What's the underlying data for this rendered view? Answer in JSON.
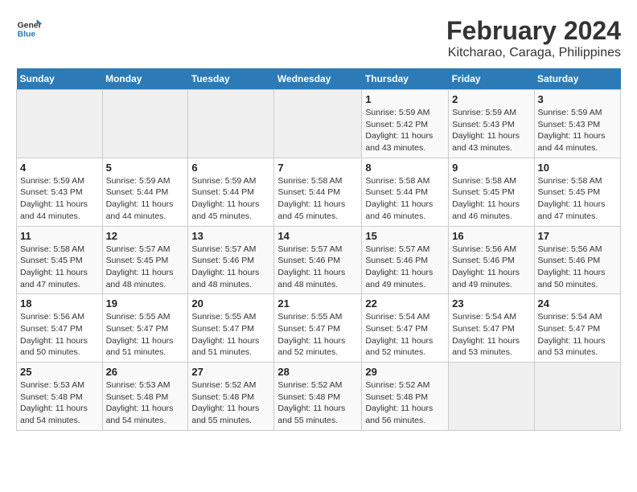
{
  "logo": {
    "text_general": "General",
    "text_blue": "Blue"
  },
  "title": "February 2024",
  "subtitle": "Kitcharao, Caraga, Philippines",
  "days_header": [
    "Sunday",
    "Monday",
    "Tuesday",
    "Wednesday",
    "Thursday",
    "Friday",
    "Saturday"
  ],
  "weeks": [
    [
      {
        "day": "",
        "info": ""
      },
      {
        "day": "",
        "info": ""
      },
      {
        "day": "",
        "info": ""
      },
      {
        "day": "",
        "info": ""
      },
      {
        "day": "1",
        "info": "Sunrise: 5:59 AM\nSunset: 5:42 PM\nDaylight: 11 hours\nand 43 minutes."
      },
      {
        "day": "2",
        "info": "Sunrise: 5:59 AM\nSunset: 5:43 PM\nDaylight: 11 hours\nand 43 minutes."
      },
      {
        "day": "3",
        "info": "Sunrise: 5:59 AM\nSunset: 5:43 PM\nDaylight: 11 hours\nand 44 minutes."
      }
    ],
    [
      {
        "day": "4",
        "info": "Sunrise: 5:59 AM\nSunset: 5:43 PM\nDaylight: 11 hours\nand 44 minutes."
      },
      {
        "day": "5",
        "info": "Sunrise: 5:59 AM\nSunset: 5:44 PM\nDaylight: 11 hours\nand 44 minutes."
      },
      {
        "day": "6",
        "info": "Sunrise: 5:59 AM\nSunset: 5:44 PM\nDaylight: 11 hours\nand 45 minutes."
      },
      {
        "day": "7",
        "info": "Sunrise: 5:58 AM\nSunset: 5:44 PM\nDaylight: 11 hours\nand 45 minutes."
      },
      {
        "day": "8",
        "info": "Sunrise: 5:58 AM\nSunset: 5:44 PM\nDaylight: 11 hours\nand 46 minutes."
      },
      {
        "day": "9",
        "info": "Sunrise: 5:58 AM\nSunset: 5:45 PM\nDaylight: 11 hours\nand 46 minutes."
      },
      {
        "day": "10",
        "info": "Sunrise: 5:58 AM\nSunset: 5:45 PM\nDaylight: 11 hours\nand 47 minutes."
      }
    ],
    [
      {
        "day": "11",
        "info": "Sunrise: 5:58 AM\nSunset: 5:45 PM\nDaylight: 11 hours\nand 47 minutes."
      },
      {
        "day": "12",
        "info": "Sunrise: 5:57 AM\nSunset: 5:45 PM\nDaylight: 11 hours\nand 48 minutes."
      },
      {
        "day": "13",
        "info": "Sunrise: 5:57 AM\nSunset: 5:46 PM\nDaylight: 11 hours\nand 48 minutes."
      },
      {
        "day": "14",
        "info": "Sunrise: 5:57 AM\nSunset: 5:46 PM\nDaylight: 11 hours\nand 48 minutes."
      },
      {
        "day": "15",
        "info": "Sunrise: 5:57 AM\nSunset: 5:46 PM\nDaylight: 11 hours\nand 49 minutes."
      },
      {
        "day": "16",
        "info": "Sunrise: 5:56 AM\nSunset: 5:46 PM\nDaylight: 11 hours\nand 49 minutes."
      },
      {
        "day": "17",
        "info": "Sunrise: 5:56 AM\nSunset: 5:46 PM\nDaylight: 11 hours\nand 50 minutes."
      }
    ],
    [
      {
        "day": "18",
        "info": "Sunrise: 5:56 AM\nSunset: 5:47 PM\nDaylight: 11 hours\nand 50 minutes."
      },
      {
        "day": "19",
        "info": "Sunrise: 5:55 AM\nSunset: 5:47 PM\nDaylight: 11 hours\nand 51 minutes."
      },
      {
        "day": "20",
        "info": "Sunrise: 5:55 AM\nSunset: 5:47 PM\nDaylight: 11 hours\nand 51 minutes."
      },
      {
        "day": "21",
        "info": "Sunrise: 5:55 AM\nSunset: 5:47 PM\nDaylight: 11 hours\nand 52 minutes."
      },
      {
        "day": "22",
        "info": "Sunrise: 5:54 AM\nSunset: 5:47 PM\nDaylight: 11 hours\nand 52 minutes."
      },
      {
        "day": "23",
        "info": "Sunrise: 5:54 AM\nSunset: 5:47 PM\nDaylight: 11 hours\nand 53 minutes."
      },
      {
        "day": "24",
        "info": "Sunrise: 5:54 AM\nSunset: 5:47 PM\nDaylight: 11 hours\nand 53 minutes."
      }
    ],
    [
      {
        "day": "25",
        "info": "Sunrise: 5:53 AM\nSunset: 5:48 PM\nDaylight: 11 hours\nand 54 minutes."
      },
      {
        "day": "26",
        "info": "Sunrise: 5:53 AM\nSunset: 5:48 PM\nDaylight: 11 hours\nand 54 minutes."
      },
      {
        "day": "27",
        "info": "Sunrise: 5:52 AM\nSunset: 5:48 PM\nDaylight: 11 hours\nand 55 minutes."
      },
      {
        "day": "28",
        "info": "Sunrise: 5:52 AM\nSunset: 5:48 PM\nDaylight: 11 hours\nand 55 minutes."
      },
      {
        "day": "29",
        "info": "Sunrise: 5:52 AM\nSunset: 5:48 PM\nDaylight: 11 hours\nand 56 minutes."
      },
      {
        "day": "",
        "info": ""
      },
      {
        "day": "",
        "info": ""
      }
    ]
  ]
}
